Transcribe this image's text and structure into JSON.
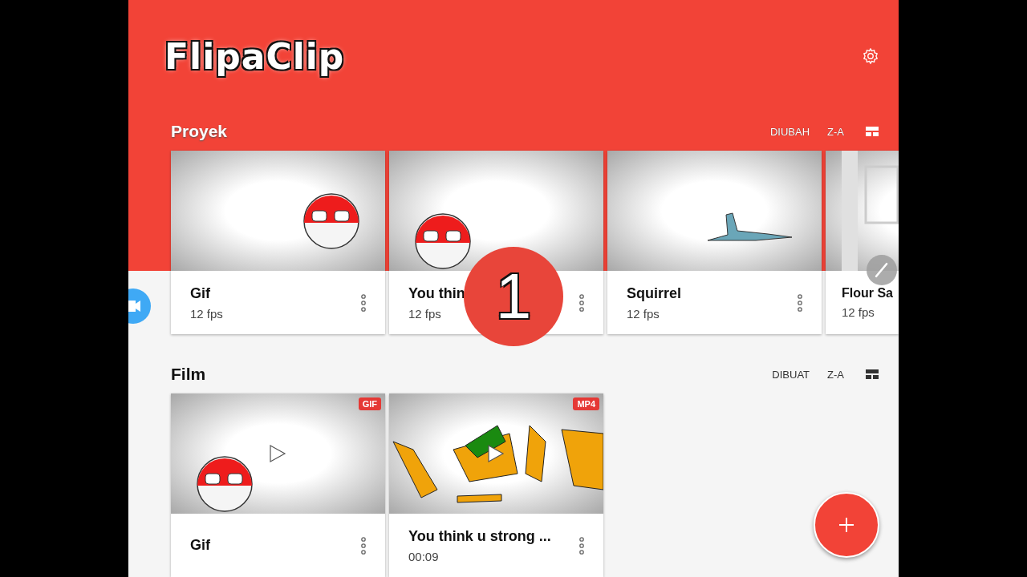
{
  "app": {
    "logo": "FlipaClip"
  },
  "sections": [
    {
      "title": "Proyek",
      "sort": "DIUBAH",
      "order": "Z-A",
      "header_on_color": true,
      "cards": [
        {
          "title": "Gif",
          "subtitle": "12 fps",
          "partial": false
        },
        {
          "title": "You thin",
          "subtitle": "12 fps",
          "partial": false
        },
        {
          "title": "Squirrel",
          "subtitle": "12 fps",
          "partial": false
        },
        {
          "title": "Flour Sa",
          "subtitle": "12 fps",
          "partial": true
        }
      ]
    },
    {
      "title": "Film",
      "sort": "DIBUAT",
      "order": "Z-A",
      "header_on_color": false,
      "cards": [
        {
          "title": "Gif",
          "format": "GIF",
          "partial": false
        },
        {
          "title": "You think u strong ...",
          "subtitle": "00:09",
          "format": "MP4",
          "partial": false
        }
      ]
    }
  ],
  "overlay": {
    "step": "1"
  }
}
